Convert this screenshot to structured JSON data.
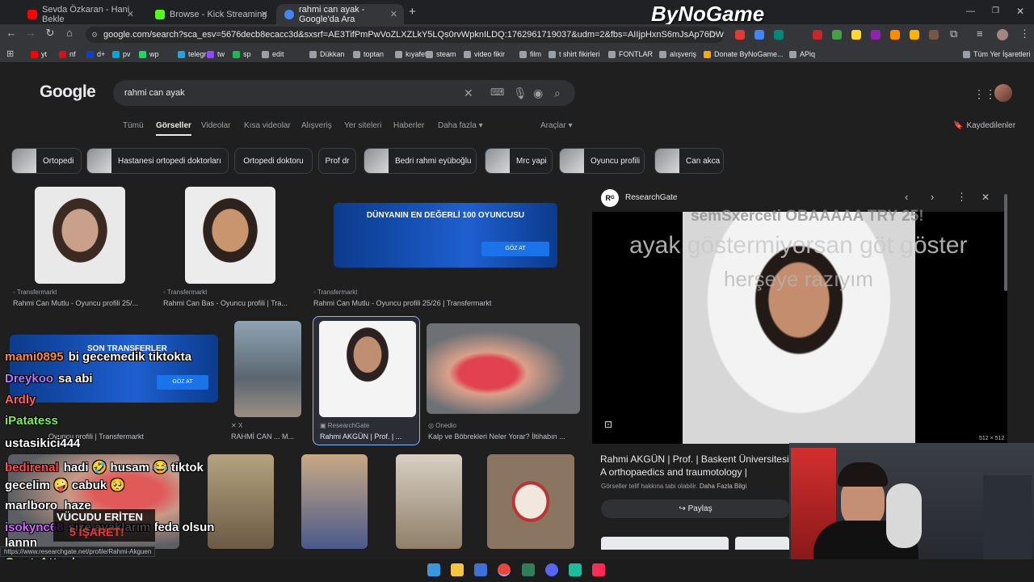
{
  "tabs": [
    {
      "label": "Sevda Özkaran - Hani Bekle",
      "fav_color": "#ff0000"
    },
    {
      "label": "Browse - Kick Streaming",
      "fav_color": "#53fc18"
    },
    {
      "label": "rahmi can ayak - Google'da Ara",
      "fav_color": "#4285f4"
    }
  ],
  "brand_overlay": "ByNoGame",
  "url": "google.com/search?sca_esv=5676decb8ecacc3d&sxsrf=AE3TifPmPwVoZLXZLkY5LQs0rvWpknILDQ:1762961719037&udm=2&fbs=AIIjpHxnS6mJsAp76DW4aLpTUC_SQPGUYQNG...",
  "bookmarks": [
    {
      "label": "yt",
      "color": "#ff0000"
    },
    {
      "label": "nf",
      "color": "#e50914"
    },
    {
      "label": "d+",
      "color": "#113ccf"
    },
    {
      "label": "pv",
      "color": "#00a8e1"
    },
    {
      "label": "wp",
      "color": "#25d366"
    },
    {
      "label": "telegr",
      "color": "#2aa1da"
    },
    {
      "label": "tw",
      "color": "#9146ff"
    },
    {
      "label": "sp",
      "color": "#1db954"
    },
    {
      "label": "edit",
      "color": "#9aa0a6"
    },
    {
      "label": "Dükkan",
      "color": "#9aa0a6"
    },
    {
      "label": "toptan",
      "color": "#9aa0a6"
    },
    {
      "label": "kıyafet",
      "color": "#9aa0a6"
    },
    {
      "label": "steam",
      "color": "#9aa0a6"
    },
    {
      "label": "video fikir",
      "color": "#9aa0a6"
    },
    {
      "label": "film",
      "color": "#9aa0a6"
    },
    {
      "label": "t shirt fikirleri",
      "color": "#9aa0a6"
    },
    {
      "label": "FONTLAR",
      "color": "#9aa0a6"
    },
    {
      "label": "alışveriş",
      "color": "#9aa0a6"
    },
    {
      "label": "Donate ByNoGame...",
      "color": "#f9ab00"
    },
    {
      "label": "APiq",
      "color": "#9aa0a6"
    }
  ],
  "all_bookmarks": "Tüm Yer İşaretleri",
  "google": {
    "logo": "Google",
    "query": "rahmi can ayak",
    "nav_tabs": [
      "Tümü",
      "Görseller",
      "Videolar",
      "Kısa videolar",
      "Alışveriş",
      "Yer siteleri",
      "Haberler",
      "Daha fazla ▾"
    ],
    "tools": "Araçlar ▾",
    "saved": "Kaydedilenler",
    "chips": [
      "Ortopedi",
      "Hastanesi ortopedi doktorları",
      "Ortopedi doktoru",
      "Prof dr",
      "Bedri rahmi eyüboğlu",
      "Mrc yapi",
      "Oyuncu profili",
      "Can akca"
    ]
  },
  "results": [
    {
      "source": "Transfermarkt",
      "caption": "Rahmi Can Mutlu - Oyuncu profili 25/..."
    },
    {
      "source": "Transfermarkt",
      "caption": "Rahmi Can Bas - Oyuncu profili | Tra..."
    },
    {
      "source": "Transfermarkt",
      "caption": "Rahmi Can Mutlu - Oyuncu profili 25/26 | Transfermarkt",
      "banner": "DÜNYANIN EN DEĞERLİ 100 OYUNCUSU",
      "banner_btn": "GÖZ AT"
    },
    {
      "source": "Transfermarkt",
      "caption": "Oyuncu profili | Transfermarkt",
      "banner": "SON TRANSFERLER",
      "banner_btn": "GÖZ AT"
    },
    {
      "source": "X",
      "caption": "RAHMİ CAN ... M..."
    },
    {
      "source": "ResearchGate",
      "caption": "Rahmi AKGÜN | Prof. | ..."
    },
    {
      "source": "Onedio",
      "caption": "Kalp ve Böbrekleri Neler Yorar? İltihabın ..."
    }
  ],
  "panel": {
    "source": "ResearchGate",
    "source_initial": "Rᴳ",
    "dims": "512 × 512",
    "title": "Rahmi AKGÜN | Prof. | Baskent Üniversitesi A orthopaedics and traumotology | Research",
    "notice": "Görseller telif hakkına tabi olabilir.",
    "learn_more": "Daha Fazla Bilgi",
    "share": "Paylaş",
    "overlay_top": "semSxerceti OBAAAAA TRY 25!",
    "overlay_line1": "ayak göstermiyorsan göt göster",
    "overlay_line2": "herşeye razıyım"
  },
  "chat": [
    {
      "user": "mami0895",
      "msg": "bi gecemedik tiktokta",
      "color": "#ff8a3d"
    },
    {
      "user": "Dreykoo",
      "msg": "sa abi",
      "color": "#b07bff"
    },
    {
      "user": "Ardly",
      "msg": "",
      "color": "#ff6060"
    },
    {
      "user": "iPatatess",
      "msg": "",
      "color": "#7cf05a"
    },
    {
      "user": "ustasikici444",
      "msg": "",
      "color": "#ffffff"
    },
    {
      "user": "bedirenal",
      "msg": "hadi 🤣 husam 😂 tiktok",
      "color": "#ff4d4d"
    },
    {
      "user": "",
      "msg": "gecelim 🤪 cabuk 🥺",
      "color": "#ffffff"
    },
    {
      "user": "marlboro_haze",
      "msg": "",
      "color": "#ffffff"
    },
    {
      "user": "isokync68",
      "msg": "size ayaklarım feda olsun",
      "color": "#d06bff"
    },
    {
      "user": "",
      "msg": "lannn",
      "color": "#ffffff"
    },
    {
      "user": "ContrAttack",
      "msg": "",
      "color": "#7cf05a"
    }
  ],
  "promo": {
    "line1": "VÜCUDU ERİTEN",
    "line2": "5 İŞARET!"
  },
  "status_url": "https://www.researchgate.net/profile/Rahmi-Akguen"
}
